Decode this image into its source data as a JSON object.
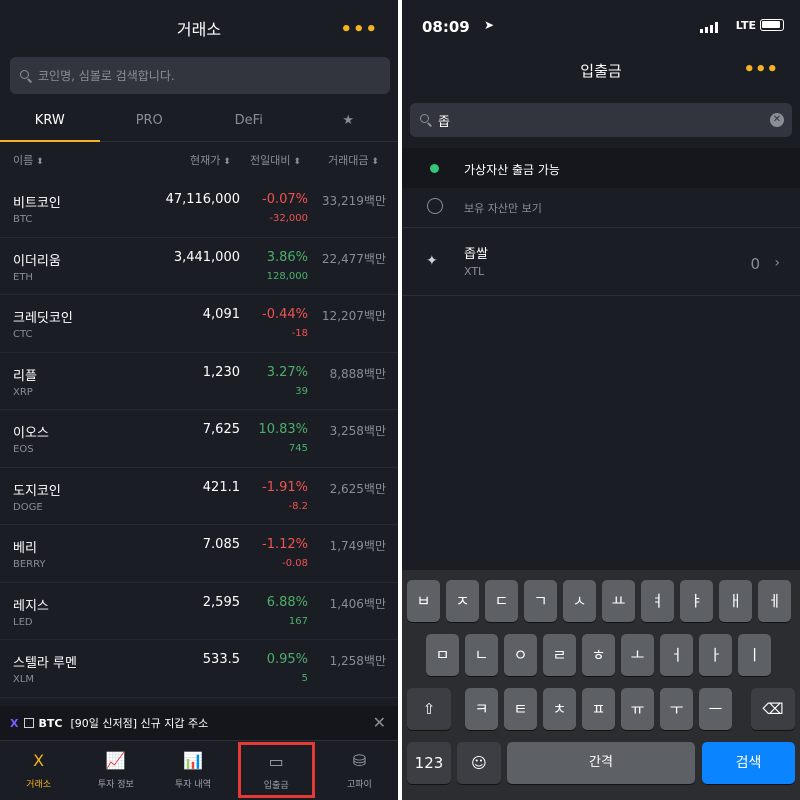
{
  "left": {
    "title": "거래소",
    "more": "•••",
    "search_placeholder": "코인명, 심볼로 검색합니다.",
    "tabs": [
      "KRW",
      "PRO",
      "DeFi",
      "★"
    ],
    "columns": {
      "name": "이름",
      "price": "현재가",
      "change": "전일대비",
      "volume": "거래대금"
    },
    "rows": [
      {
        "name": "비트코인",
        "symbol": "BTC",
        "price": "47,116,000",
        "pct": "-0.07%",
        "change": "-32,000",
        "volume": "33,219백만",
        "dir": "down"
      },
      {
        "name": "이더리움",
        "symbol": "ETH",
        "price": "3,441,000",
        "pct": "3.86%",
        "change": "128,000",
        "volume": "22,477백만",
        "dir": "up"
      },
      {
        "name": "크레딧코인",
        "symbol": "CTC",
        "price": "4,091",
        "pct": "-0.44%",
        "change": "-18",
        "volume": "12,207백만",
        "dir": "down"
      },
      {
        "name": "리플",
        "symbol": "XRP",
        "price": "1,230",
        "pct": "3.27%",
        "change": "39",
        "volume": "8,888백만",
        "dir": "up"
      },
      {
        "name": "이오스",
        "symbol": "EOS",
        "price": "7,625",
        "pct": "10.83%",
        "change": "745",
        "volume": "3,258백만",
        "dir": "up"
      },
      {
        "name": "도지코인",
        "symbol": "DOGE",
        "price": "421.1",
        "pct": "-1.91%",
        "change": "-8.2",
        "volume": "2,625백만",
        "dir": "down"
      },
      {
        "name": "베리",
        "symbol": "BERRY",
        "price": "7.085",
        "pct": "-1.12%",
        "change": "-0.08",
        "volume": "1,749백만",
        "dir": "down"
      },
      {
        "name": "레지스",
        "symbol": "LED",
        "price": "2,595",
        "pct": "6.88%",
        "change": "167",
        "volume": "1,406백만",
        "dir": "up"
      },
      {
        "name": "스텔라 루멘",
        "symbol": "XLM",
        "price": "533.5",
        "pct": "0.95%",
        "change": "5",
        "volume": "1,258백만",
        "dir": "up"
      }
    ],
    "banner": {
      "logo": "X",
      "coin": "BTC",
      "text": "[90일 신저점] 신규 지갑 주소"
    },
    "nav": [
      {
        "label": "거래소",
        "icon": "X",
        "icon_name": "exchange-icon"
      },
      {
        "label": "투자 정보",
        "icon": "📈",
        "icon_name": "chart-icon"
      },
      {
        "label": "투자 내역",
        "icon": "📊",
        "icon_name": "history-icon"
      },
      {
        "label": "입출금",
        "icon": "▭",
        "icon_name": "wallet-icon"
      },
      {
        "label": "고파이",
        "icon": "⛁",
        "icon_name": "coins-icon"
      }
    ],
    "colors": {
      "accent": "#f5b321",
      "up": "#4caf6a",
      "down": "#ef5350",
      "highlight": "#e53935"
    }
  },
  "right": {
    "status": {
      "time": "08:09",
      "network": "LTE"
    },
    "title": "입출금",
    "more": "•••",
    "search_value": "좁",
    "filters": [
      "가상자산 출금 가능",
      "보유 자산만 보기"
    ],
    "coin": {
      "name": "좁쌀",
      "symbol": "XTL",
      "balance": "0"
    },
    "keyboard": {
      "row1": [
        "ㅂ",
        "ㅈ",
        "ㄷ",
        "ㄱ",
        "ㅅ",
        "ㅛ",
        "ㅕ",
        "ㅑ",
        "ㅐ",
        "ㅔ"
      ],
      "row2": [
        "ㅁ",
        "ㄴ",
        "ㅇ",
        "ㄹ",
        "ㅎ",
        "ㅗ",
        "ㅓ",
        "ㅏ",
        "ㅣ"
      ],
      "row3": [
        "ㅋ",
        "ㅌ",
        "ㅊ",
        "ㅍ",
        "ㅠ",
        "ㅜ",
        "ㅡ"
      ],
      "numbers": "123",
      "space": "간격",
      "search": "검색"
    }
  }
}
